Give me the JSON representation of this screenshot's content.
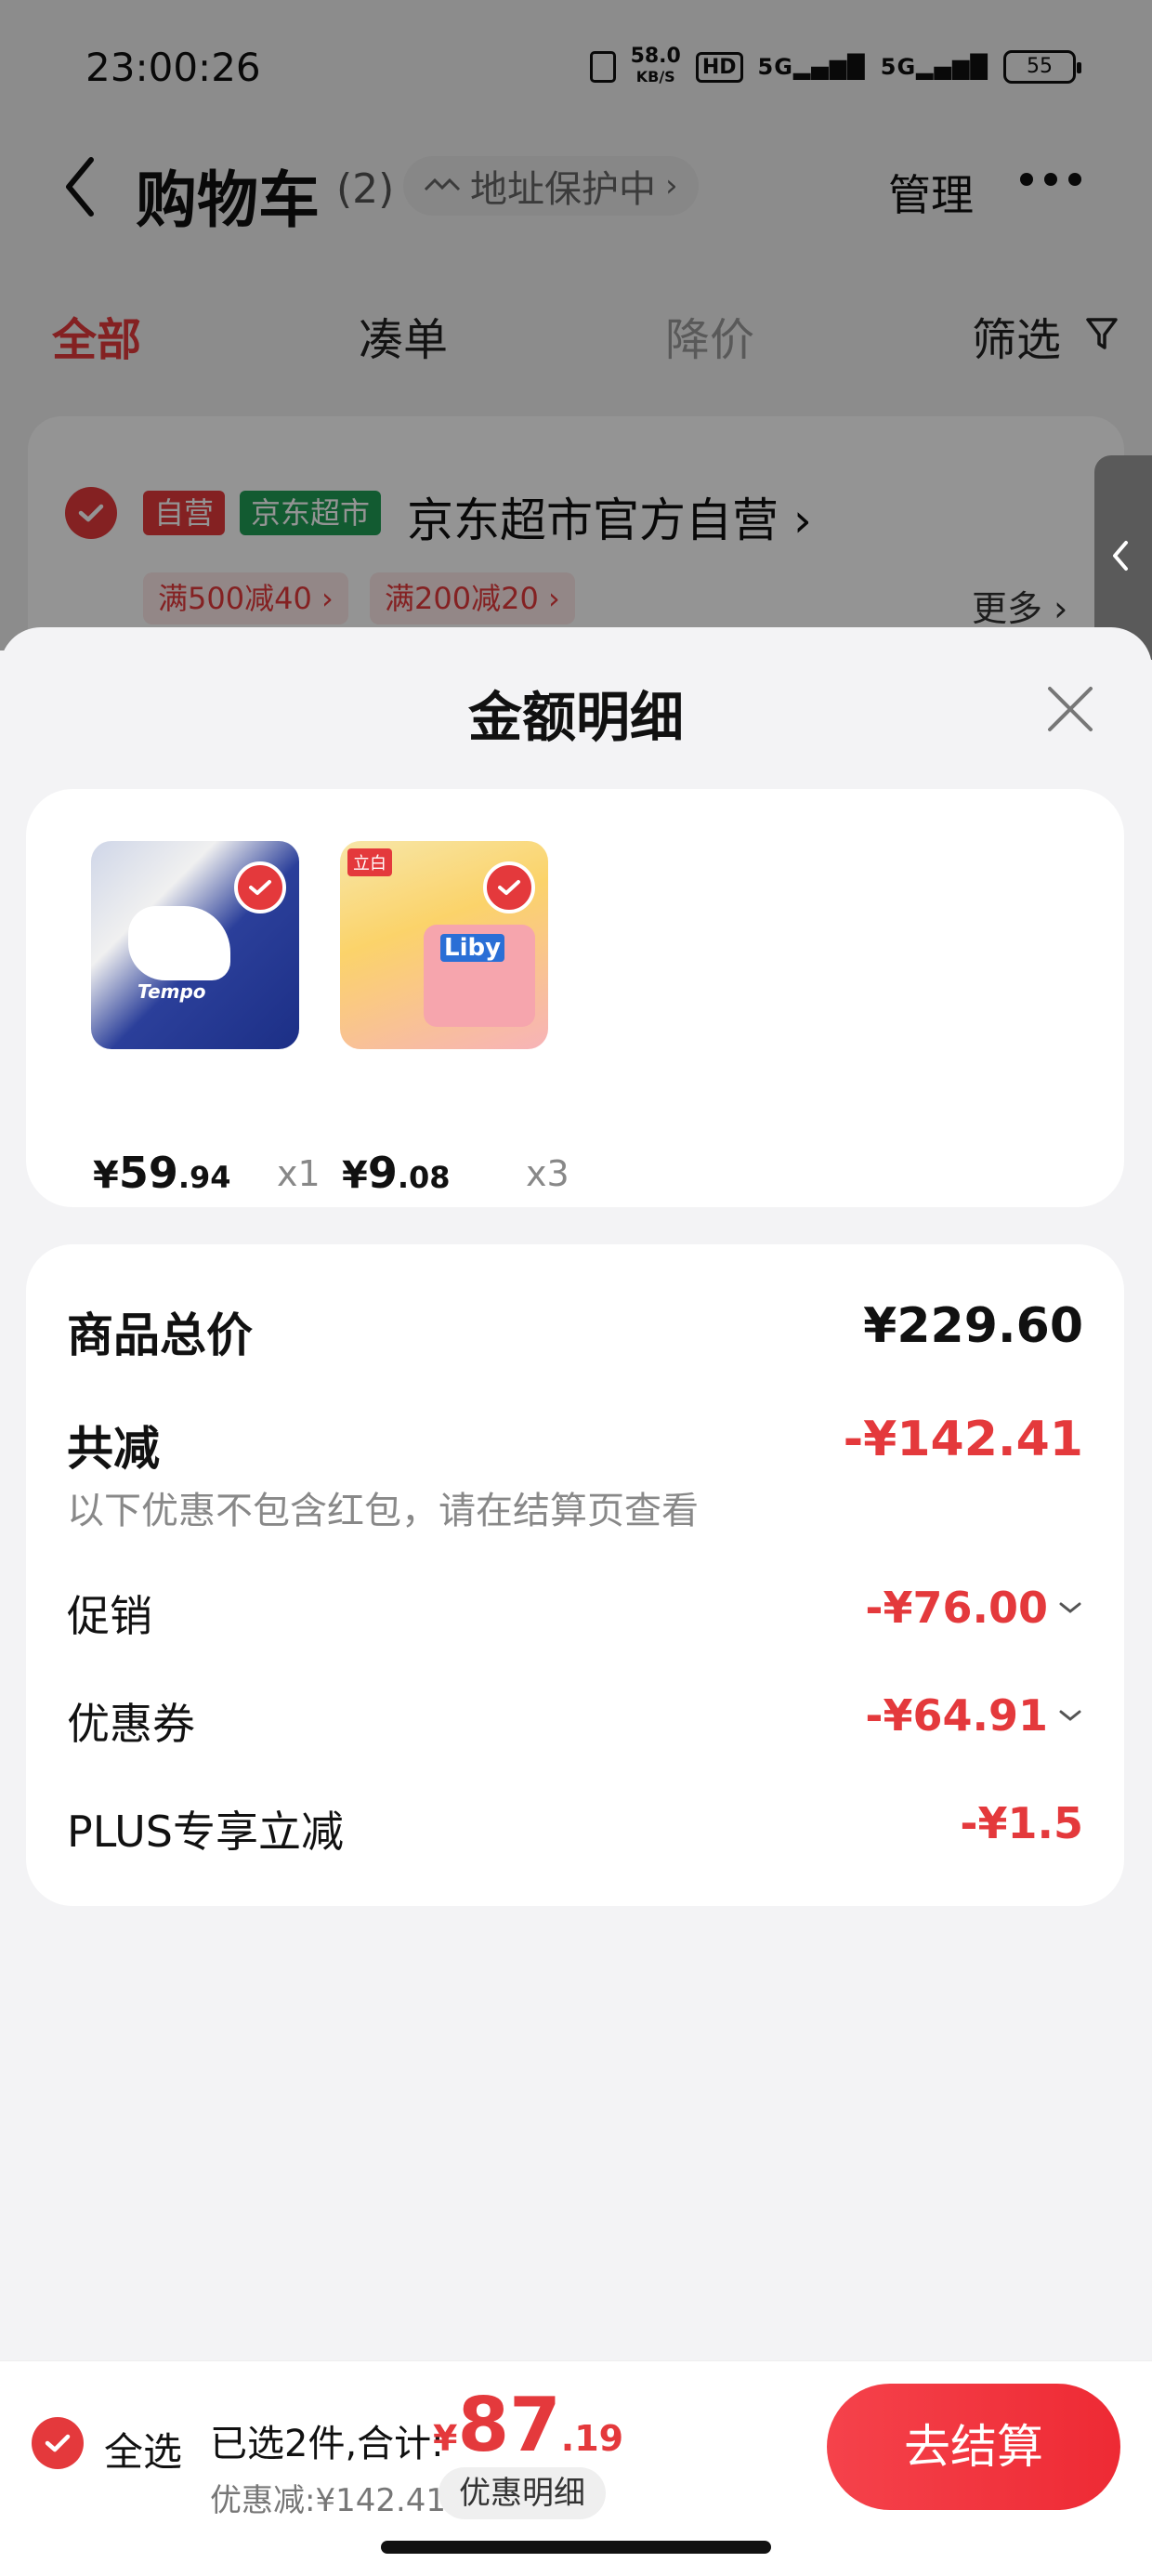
{
  "status_bar": {
    "time": "23:00:26",
    "net_speed_top": "58.0",
    "net_speed_unit": "KB/S",
    "hd_label": "HD",
    "signal1": "5G",
    "signal2": "5G",
    "battery": "55"
  },
  "header": {
    "title": "购物车",
    "count": "(2)",
    "address_chip": "地址保护中",
    "manage": "管理"
  },
  "filter_tabs": [
    {
      "label": "全部"
    },
    {
      "label": "凑单"
    },
    {
      "label": "降价"
    },
    {
      "label": "筛选"
    }
  ],
  "store": {
    "tag_self": "自营",
    "tag_jd": "京东超市",
    "name": "京东超市官方自营",
    "promos": [
      "满500减40",
      "满200减20"
    ],
    "more": "更多"
  },
  "sheet": {
    "title": "金额明细",
    "goods": [
      {
        "name": "tempo-tissue",
        "price_yen": "¥",
        "price_int": "59",
        "price_dec": ".94",
        "qty": "x1"
      },
      {
        "name": "liby-detergent",
        "badge": "立白",
        "price_yen": "¥",
        "price_int": "9",
        "price_dec": ".08",
        "qty": "x3"
      }
    ],
    "summary": {
      "total_label": "商品总价",
      "total_value": "¥229.60",
      "reduce_label": "共减",
      "reduce_value": "-¥142.41",
      "reduce_note": "以下优惠不包含红包，请在结算页查看",
      "promo_label": "促销",
      "promo_value": "-¥76.00",
      "coupon_label": "优惠券",
      "coupon_value": "-¥64.91",
      "plus_label": "PLUS专享立减",
      "plus_value": "-¥1.5"
    }
  },
  "bottom_bar": {
    "select_all": "全选",
    "selected": "已选2件,合计:",
    "total_yen": "¥",
    "total_int": "87",
    "total_dec": ".19",
    "discount": "优惠减:¥142.41",
    "detail_chip": "优惠明细",
    "checkout": "去结算"
  },
  "colors": {
    "accent": "#e4393c",
    "jd_green": "#1f9d55"
  }
}
